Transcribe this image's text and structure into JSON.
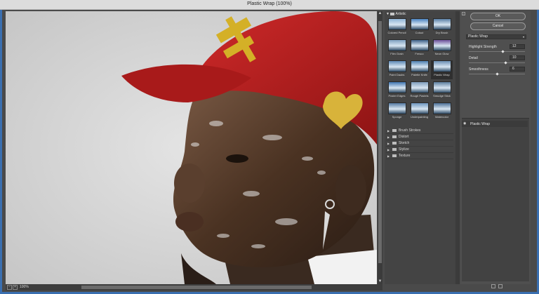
{
  "window": {
    "title": "Plastic Wrap (100%)"
  },
  "status": {
    "zoom": "100%",
    "zoom_minus": "−",
    "zoom_plus": "+"
  },
  "gallery": {
    "category_open": "Artistic",
    "thumbnails": [
      {
        "label": "Colored Pencil",
        "tone": "#8fb4d6"
      },
      {
        "label": "Cutout",
        "tone": "#4a83c0"
      },
      {
        "label": "Dry Brush",
        "tone": "#5a7fa5"
      },
      {
        "label": "Film Grain",
        "tone": "#7e9fbf"
      },
      {
        "label": "Fresco",
        "tone": "#3c5f86"
      },
      {
        "label": "Neon Glow",
        "tone": "#6c4f9a"
      },
      {
        "label": "Paint Daubs",
        "tone": "#5d89b6"
      },
      {
        "label": "Palette Knife",
        "tone": "#4d7fb1"
      },
      {
        "label": "Plastic Wrap",
        "tone": "#6a8eb3"
      },
      {
        "label": "Poster Edges",
        "tone": "#3f74b0"
      },
      {
        "label": "Rough Pastels",
        "tone": "#7e9cbc"
      },
      {
        "label": "Smudge Stick",
        "tone": "#5d7e9e"
      },
      {
        "label": "Sponge",
        "tone": "#5479a1"
      },
      {
        "label": "Underpainting",
        "tone": "#6d95be"
      },
      {
        "label": "Watercolor",
        "tone": "#4b6f96"
      }
    ],
    "categories": [
      "Brush Strokes",
      "Distort",
      "Sketch",
      "Stylize",
      "Texture"
    ]
  },
  "side": {
    "ok_label": "OK",
    "cancel_label": "Cancel",
    "filter_select": "Plastic Wrap",
    "params": [
      {
        "label": "Highlight Strength",
        "value": "12",
        "level": 0.6
      },
      {
        "label": "Detail",
        "value": "10",
        "level": 0.66
      },
      {
        "label": "Smoothness",
        "value": "6",
        "level": 0.5
      }
    ],
    "layer_name": "Plastic Wrap"
  }
}
